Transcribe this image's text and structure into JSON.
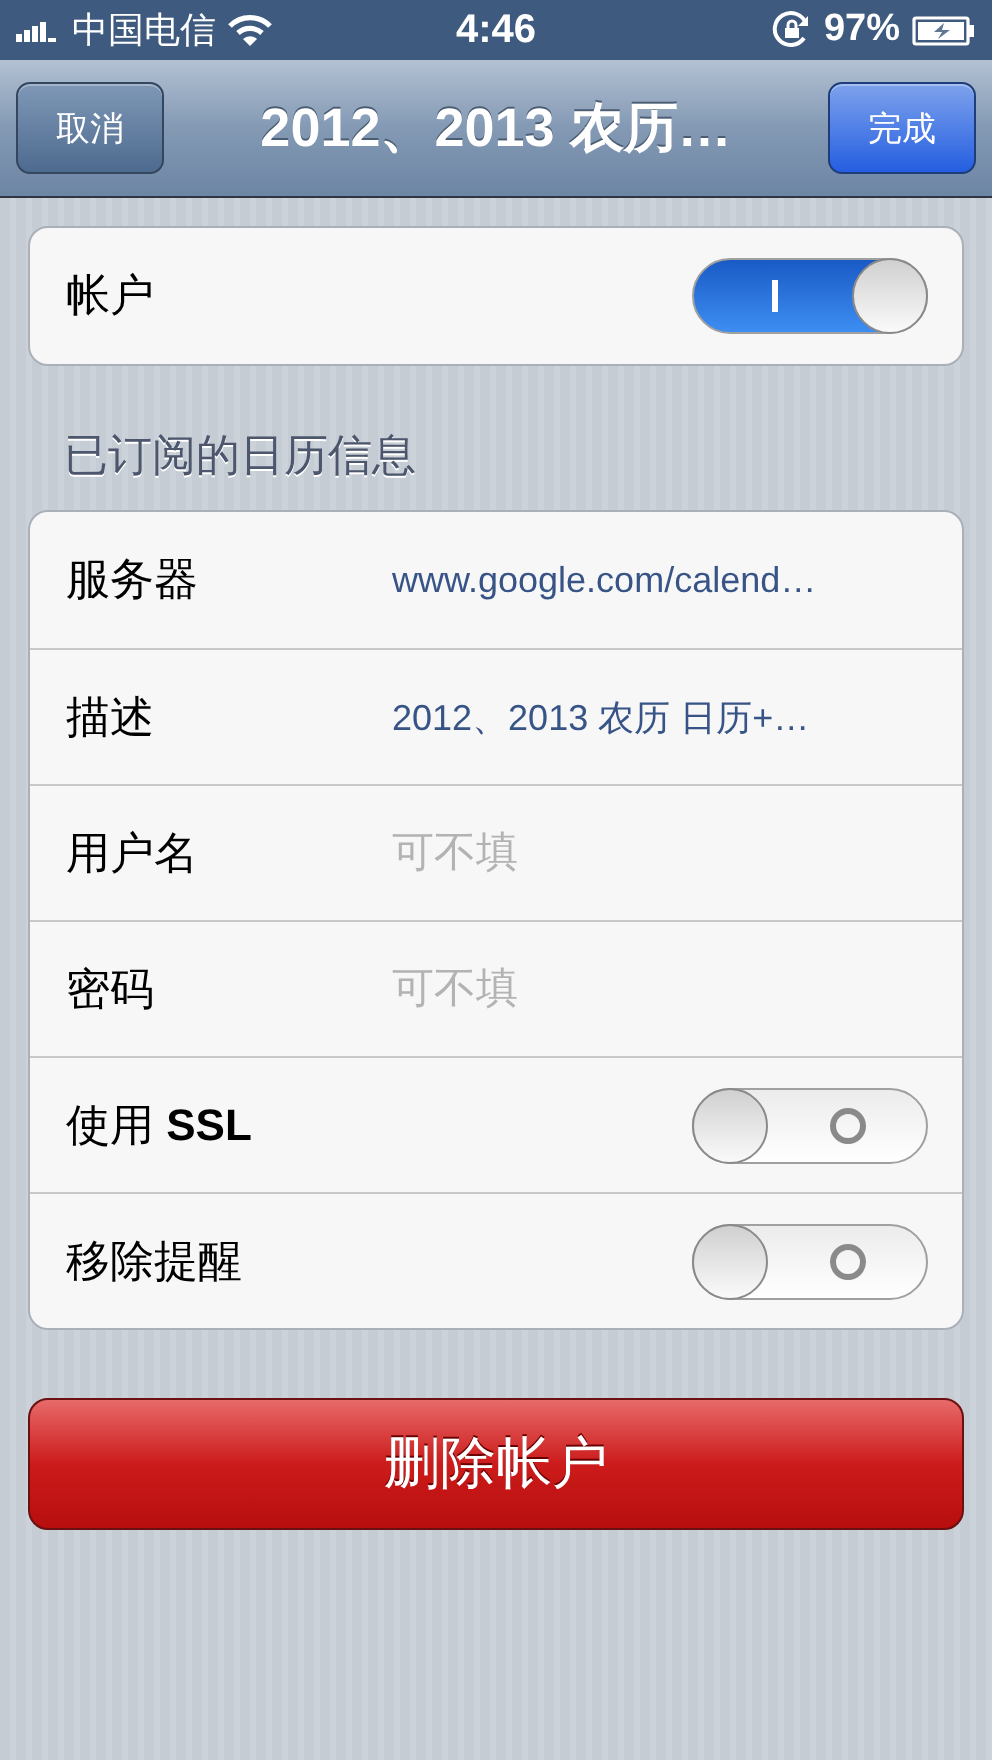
{
  "status_bar": {
    "carrier": "中国电信",
    "time": "4:46",
    "battery": "97%"
  },
  "nav": {
    "cancel": "取消",
    "title": "2012、2013 农历…",
    "done": "完成"
  },
  "account": {
    "label": "帐户",
    "on": true
  },
  "section_title": "已订阅的日历信息",
  "rows": [
    {
      "kind": "field",
      "label": "服务器",
      "value": "www.google.com/calend…"
    },
    {
      "kind": "field",
      "label": "描述",
      "value": "2012、2013 农历 日历+…"
    },
    {
      "kind": "field",
      "label": "用户名",
      "placeholder": "可不填"
    },
    {
      "kind": "field",
      "label": "密码",
      "placeholder": "可不填"
    },
    {
      "kind": "toggle",
      "label": "使用 **SSL**",
      "on": false
    },
    {
      "kind": "toggle",
      "label": "移除提醒",
      "on": false
    }
  ],
  "delete_button": "删除帐户"
}
